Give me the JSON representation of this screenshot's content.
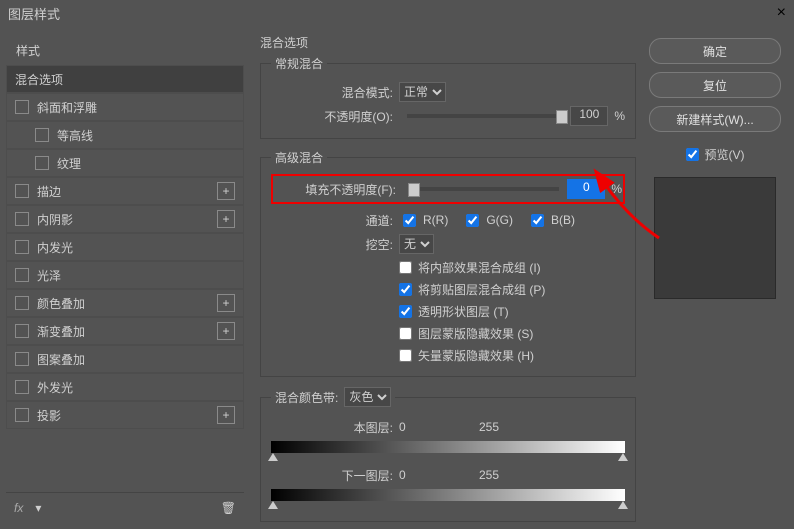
{
  "window": {
    "title": "图层样式"
  },
  "sidebar": {
    "title": "样式",
    "items": [
      {
        "label": "混合选项",
        "selected": true
      },
      {
        "label": "斜面和浮雕"
      },
      {
        "label": "等高线",
        "indent": true
      },
      {
        "label": "纹理",
        "indent": true
      },
      {
        "label": "描边",
        "plus": true
      },
      {
        "label": "内阴影",
        "plus": true
      },
      {
        "label": "内发光"
      },
      {
        "label": "光泽"
      },
      {
        "label": "颜色叠加",
        "plus": true
      },
      {
        "label": "渐变叠加",
        "plus": true
      },
      {
        "label": "图案叠加"
      },
      {
        "label": "外发光"
      },
      {
        "label": "投影",
        "plus": true
      }
    ],
    "footer": {
      "fx": "fx"
    }
  },
  "options": {
    "title": "混合选项",
    "normal": {
      "legend": "常规混合",
      "mode_label": "混合模式:",
      "mode_value": "正常",
      "opacity_label": "不透明度(O):",
      "opacity_value": "100",
      "pct": "%"
    },
    "advanced": {
      "legend": "高级混合",
      "fill_label": "填充不透明度(F):",
      "fill_value": "0",
      "pct": "%",
      "channel_label": "通道:",
      "r": "R(R)",
      "g": "G(G)",
      "b": "B(B)",
      "knockout_label": "挖空:",
      "knockout_value": "无",
      "opts": [
        {
          "label": "将内部效果混合成组 (I)",
          "checked": false
        },
        {
          "label": "将剪贴图层混合成组 (P)",
          "checked": true
        },
        {
          "label": "透明形状图层 (T)",
          "checked": true
        },
        {
          "label": "图层蒙版隐藏效果 (S)",
          "checked": false
        },
        {
          "label": "矢量蒙版隐藏效果 (H)",
          "checked": false
        }
      ]
    },
    "blendif": {
      "legend": "混合颜色带:",
      "gray": "灰色",
      "this_label": "本图层:",
      "next_label": "下一图层:",
      "v0": "0",
      "v255": "255"
    }
  },
  "right": {
    "ok": "确定",
    "reset": "复位",
    "newstyle": "新建样式(W)...",
    "preview": "预览(V)"
  }
}
